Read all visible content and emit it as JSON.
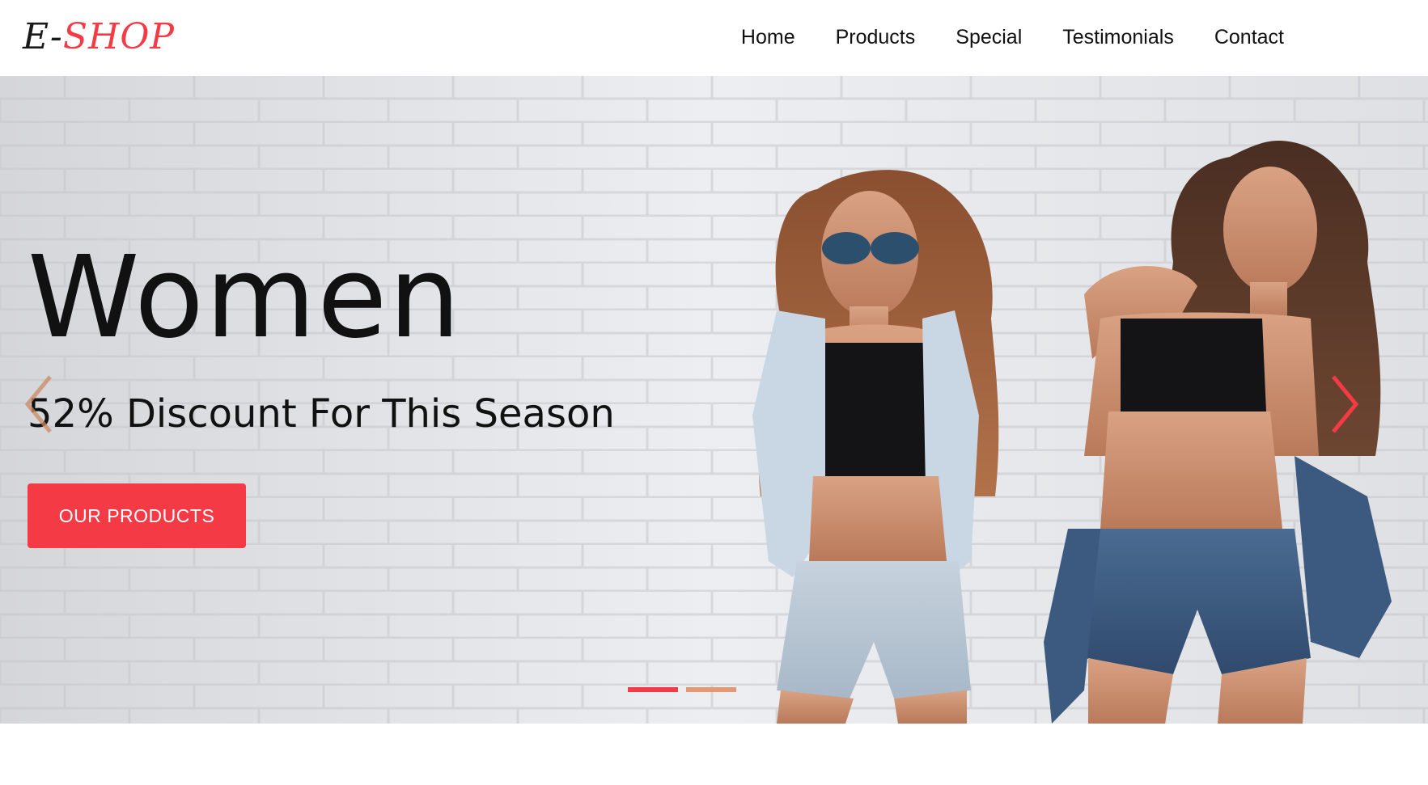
{
  "brand": {
    "prefix": "E-",
    "suffix": "SHOP",
    "accent_color": "#f33a45"
  },
  "nav": {
    "items": [
      {
        "label": "Home"
      },
      {
        "label": "Products"
      },
      {
        "label": "Special"
      },
      {
        "label": "Testimonials"
      },
      {
        "label": "Contact"
      }
    ]
  },
  "hero": {
    "title": "Women",
    "subtitle": "52% Discount For This Season",
    "cta_label": "OUR PRODUCTS",
    "prev_icon": "chevron-left-icon",
    "next_icon": "chevron-right-icon",
    "slides": [
      {
        "active": true,
        "color": "#f33a45"
      },
      {
        "active": false,
        "color": "#e29a74"
      }
    ]
  }
}
